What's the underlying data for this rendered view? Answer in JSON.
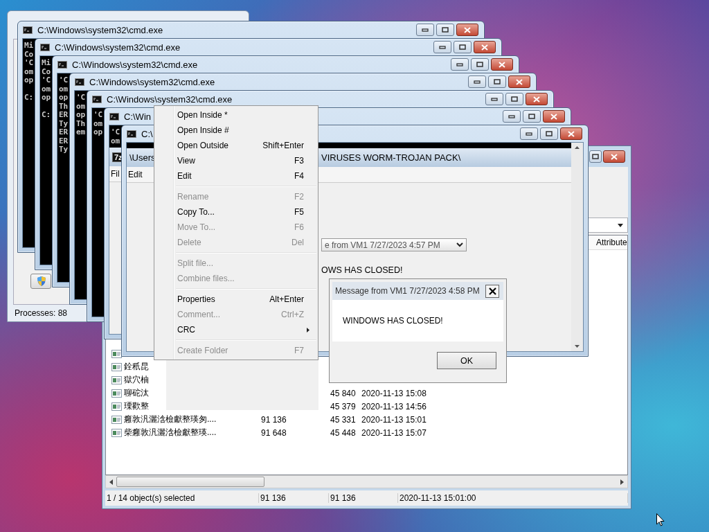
{
  "task_manager": {
    "status": "Processes: 88"
  },
  "consoles": [
    {
      "title": "C:\\Windows\\system32\\cmd.exe",
      "blocks": [
        [
          "Mi",
          "Co",
          "'C",
          "om",
          "op"
        ],
        [
          "C:"
        ]
      ]
    },
    {
      "title": "C:\\Windows\\system32\\cmd.exe",
      "blocks": [
        [
          "Mi",
          "Co",
          "'C",
          "om",
          "op"
        ],
        [
          "C:"
        ]
      ]
    },
    {
      "title": "C:\\Windows\\system32\\cmd.exe",
      "blocks": [
        [
          "'C",
          "om",
          "op",
          "Th",
          "ER",
          "Ty",
          "ER",
          "ER",
          "Ty"
        ]
      ]
    },
    {
      "title": "C:\\Windows\\system32\\cmd.exe",
      "blocks": [
        [
          "'C",
          "om",
          "op",
          "Th",
          "em"
        ]
      ]
    },
    {
      "title": "C:\\Windows\\system32\\cmd.exe",
      "blocks": [
        [
          "'C",
          "om",
          "op"
        ]
      ]
    },
    {
      "title": "C:\\Win",
      "blocks": [
        [
          "'C",
          "om"
        ]
      ],
      "ghost": {
        "logo": "7z",
        "menu": "Fil"
      }
    },
    {
      "title": "C:\\",
      "ghost": {
        "path_start": "\\Users",
        "path_end": "VIRUSES WORM-TROJAN PACK\\",
        "menu": "Edit",
        "combo": "e from VM1 7/27/2023 4:57 PM",
        "message": "OWS HAS CLOSED!"
      }
    }
  ],
  "file_manager": {
    "column_header": "Attribute",
    "rows": [
      {
        "kind": "file"
      },
      {
        "kind": "file",
        "name": "銓秖昆"
      },
      {
        "kind": "file",
        "name": "獄穴柚"
      },
      {
        "kind": "file",
        "name": "聊砣汰",
        "packed": "45 840",
        "modified": "2020-11-13 15:08"
      },
      {
        "kind": "file",
        "name": "瑮歡整",
        "packed": "45 379",
        "modified": "2020-11-13 14:56"
      },
      {
        "kind": "file",
        "name": "癰敦汎灑浛檢獻整瑛匆....",
        "size": "91 136",
        "packed": "45 331",
        "modified": "2020-11-13 15:01"
      },
      {
        "kind": "file",
        "name": "柴癰敦汎灑浛檢獻整瑛....",
        "size": "91 648",
        "packed": "45 448",
        "modified": "2020-11-13 15:07"
      }
    ],
    "status": [
      "1 / 14 object(s) selected",
      "91 136",
      "91 136",
      "2020-11-13 15:01:00"
    ]
  },
  "menu": {
    "groups": [
      {
        "items": [
          {
            "kind": "command",
            "label": "Open Inside *",
            "disabled": false
          },
          {
            "kind": "command",
            "label": "Open Inside #",
            "disabled": false
          },
          {
            "kind": "command",
            "label": "Open Outside",
            "shortcut": "Shift+Enter",
            "disabled": false
          },
          {
            "kind": "command",
            "label": "View",
            "shortcut": "F3",
            "disabled": false
          },
          {
            "kind": "command",
            "label": "Edit",
            "shortcut": "F4",
            "disabled": false
          }
        ]
      },
      {
        "items": [
          {
            "kind": "command",
            "label": "Rename",
            "shortcut": "F2",
            "disabled": true
          },
          {
            "kind": "command",
            "label": "Copy To...",
            "shortcut": "F5",
            "disabled": false
          },
          {
            "kind": "command",
            "label": "Move To...",
            "shortcut": "F6",
            "disabled": true
          },
          {
            "kind": "command",
            "label": "Delete",
            "shortcut": "Del",
            "disabled": true
          }
        ]
      },
      {
        "items": [
          {
            "kind": "command",
            "label": "Split file...",
            "disabled": true
          },
          {
            "kind": "command",
            "label": "Combine files...",
            "disabled": true
          }
        ]
      },
      {
        "items": [
          {
            "kind": "command",
            "label": "Properties",
            "shortcut": "Alt+Enter",
            "disabled": false
          },
          {
            "kind": "command",
            "label": "Comment...",
            "shortcut": "Ctrl+Z",
            "disabled": true
          },
          {
            "kind": "submenu",
            "label": "CRC",
            "disabled": false
          }
        ]
      },
      {
        "items": [
          {
            "kind": "command",
            "label": "Create Folder",
            "shortcut": "F7",
            "disabled": true
          }
        ]
      }
    ]
  },
  "message_box": {
    "title": "Message from VM1 7/27/2023 4:58 PM",
    "text": "WINDOWS HAS CLOSED!",
    "button": "OK"
  }
}
